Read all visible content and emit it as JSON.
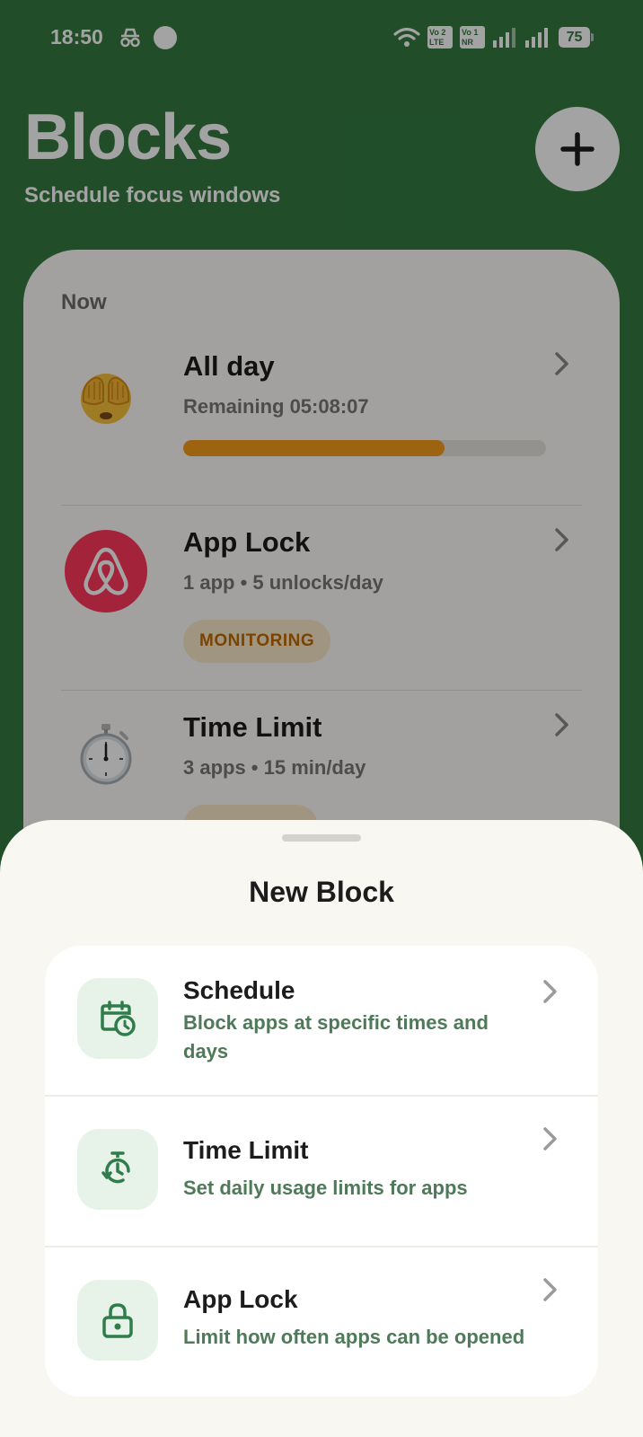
{
  "status_bar": {
    "time": "18:50",
    "icons": [
      "incognito-icon",
      "dot-icon",
      "wifi-icon",
      "volte-lte-icon",
      "volte-nr-icon",
      "signal-icon",
      "signal-icon"
    ],
    "volte1": {
      "line1": "Vo 2",
      "line2": "LTE"
    },
    "volte2": {
      "line1": "Vo 1",
      "line2": "NR"
    },
    "battery": "75"
  },
  "header": {
    "title": "Blocks",
    "subtitle": "Schedule focus windows",
    "add_icon": "plus-icon"
  },
  "blocks": {
    "section_label": "Now",
    "items": [
      {
        "title": "All day",
        "subtitle": "Remaining 05:08:07",
        "icon": "see-no-evil-emoji-icon",
        "progress": 0.72
      },
      {
        "title": "App Lock",
        "subtitle": "1 app • 5 unlocks/day",
        "icon": "airbnb-app-icon",
        "status": "MONITORING"
      },
      {
        "title": "Time Limit",
        "subtitle": "3 apps • 15 min/day",
        "icon": "stopwatch-icon"
      }
    ]
  },
  "sheet": {
    "title": "New Block",
    "options": [
      {
        "title": "Schedule",
        "description": "Block apps at specific times and days",
        "icon": "calendar-clock-icon"
      },
      {
        "title": "Time Limit",
        "description": "Set daily usage limits for apps",
        "icon": "timer-icon"
      },
      {
        "title": "App Lock",
        "description": "Limit how often apps can be opened",
        "icon": "lock-icon"
      }
    ]
  },
  "colors": {
    "background": "#347a41",
    "accent": "#2e7d4a",
    "progress": "#f59c1c",
    "badge_text": "#bf6a00",
    "badge_bg": "#fbeac9",
    "airbnb": "#ff385c"
  }
}
